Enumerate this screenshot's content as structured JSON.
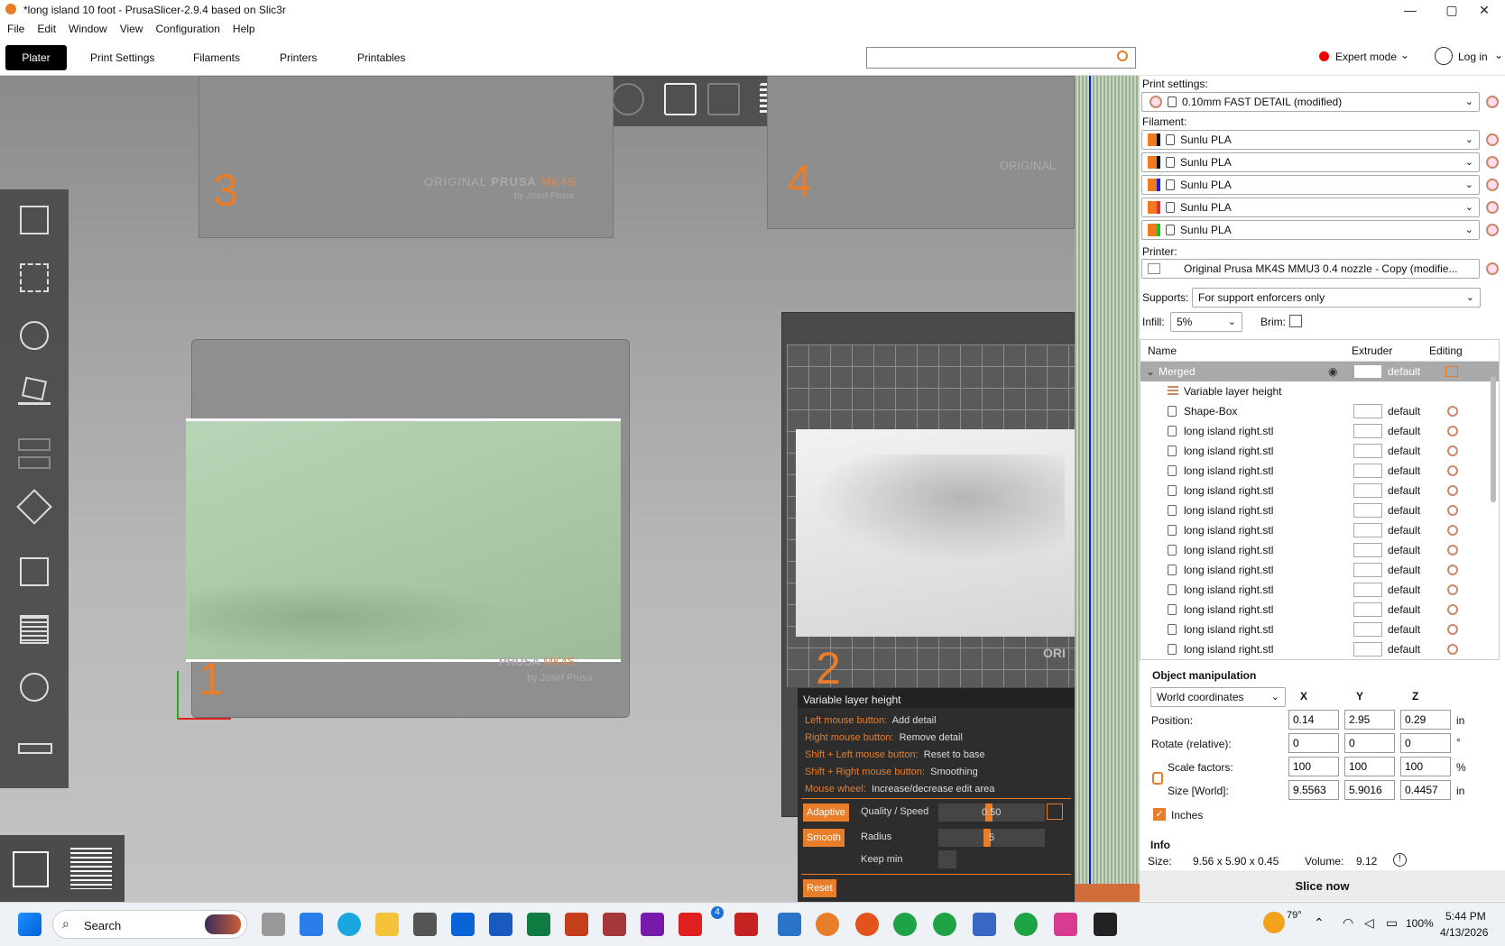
{
  "window": {
    "title": "*long island 10 foot - PrusaSlicer-2.9.4 based on Slic3r"
  },
  "menu": [
    "File",
    "Edit",
    "Window",
    "View",
    "Configuration",
    "Help"
  ],
  "tabs": [
    "Plater",
    "Print Settings",
    "Filaments",
    "Printers",
    "Printables"
  ],
  "header": {
    "mode": "Expert mode",
    "login": "Log in",
    "search_placeholder": ""
  },
  "plates": {
    "p1": "1",
    "p2": "2",
    "p3": "3",
    "p4": "4",
    "brand": "ORIGINAL",
    "brand2": "PRUSA",
    "model": "MK4S",
    "by": "by Josef Prusa",
    "ori": "ORI"
  },
  "print_settings": {
    "label": "Print settings:",
    "value": "0.10mm FAST DETAIL (modified)"
  },
  "filament": {
    "label": "Filament:",
    "items": [
      {
        "name": "Sunlu PLA",
        "c1": "#f47a20",
        "c2": "#111111"
      },
      {
        "name": "Sunlu PLA",
        "c1": "#f47a20",
        "c2": "#111111"
      },
      {
        "name": "Sunlu PLA",
        "c1": "#f47a20",
        "c2": "#2222cc"
      },
      {
        "name": "Sunlu PLA",
        "c1": "#f47a20",
        "c2": "#e03030"
      },
      {
        "name": "Sunlu PLA",
        "c1": "#f47a20",
        "c2": "#20c020"
      }
    ]
  },
  "printer": {
    "label": "Printer:",
    "value": "Original Prusa MK4S MMU3 0.4 nozzle - Copy (modifie..."
  },
  "supports": {
    "label": "Supports:",
    "value": "For support enforcers only"
  },
  "infill": {
    "label": "Infill:",
    "value": "5%"
  },
  "brim": {
    "label": "Brim:"
  },
  "objlist": {
    "col_name": "Name",
    "col_extruder": "Extruder",
    "col_editing": "Editing",
    "merged": "Merged",
    "merged_ext": "default",
    "vlh": "Variable layer height",
    "shape": "Shape-Box",
    "default": "default",
    "item": "long island right.stl"
  },
  "manip": {
    "title": "Object manipulation",
    "coords": "World coordinates",
    "x": "X",
    "y": "Y",
    "z": "Z",
    "position_label": "Position:",
    "rotate_label": "Rotate (relative):",
    "scale_label": "Scale factors:",
    "size_label": "Size [World]:",
    "position": [
      "0.14",
      "2.95",
      "0.29"
    ],
    "rotate": [
      "0",
      "0",
      "0"
    ],
    "scale": [
      "100",
      "100",
      "100"
    ],
    "size": [
      "9.5563",
      "5.9016",
      "0.4457"
    ],
    "unit_in": "in",
    "unit_deg": "°",
    "unit_pct": "%",
    "inches": "Inches"
  },
  "info": {
    "title": "Info",
    "size_label": "Size:",
    "size": "9.56 x 5.90 x 0.45",
    "volume_label": "Volume:",
    "volume": "9.12"
  },
  "slice": "Slice now",
  "vlh": {
    "title": "Variable layer height",
    "rows": [
      {
        "k": "Left mouse button:",
        "v": "Add detail"
      },
      {
        "k": "Right mouse button:",
        "v": "Remove detail"
      },
      {
        "k": "Shift + Left mouse button:",
        "v": "Reset to base"
      },
      {
        "k": "Shift + Right mouse button:",
        "v": "Smoothing"
      },
      {
        "k": "Mouse wheel:",
        "v": "Increase/decrease edit area"
      }
    ],
    "adaptive": "Adaptive",
    "quality": "Quality / Speed",
    "quality_val": "0.50",
    "smooth": "Smooth",
    "radius": "Radius",
    "radius_val": "5",
    "keepmin": "Keep min",
    "reset": "Reset"
  },
  "taskbar": {
    "search": "Search",
    "temp": "79°",
    "battery": "100%",
    "time": "5:44 PM",
    "date": "4/13/2026",
    "badge1": "4"
  }
}
